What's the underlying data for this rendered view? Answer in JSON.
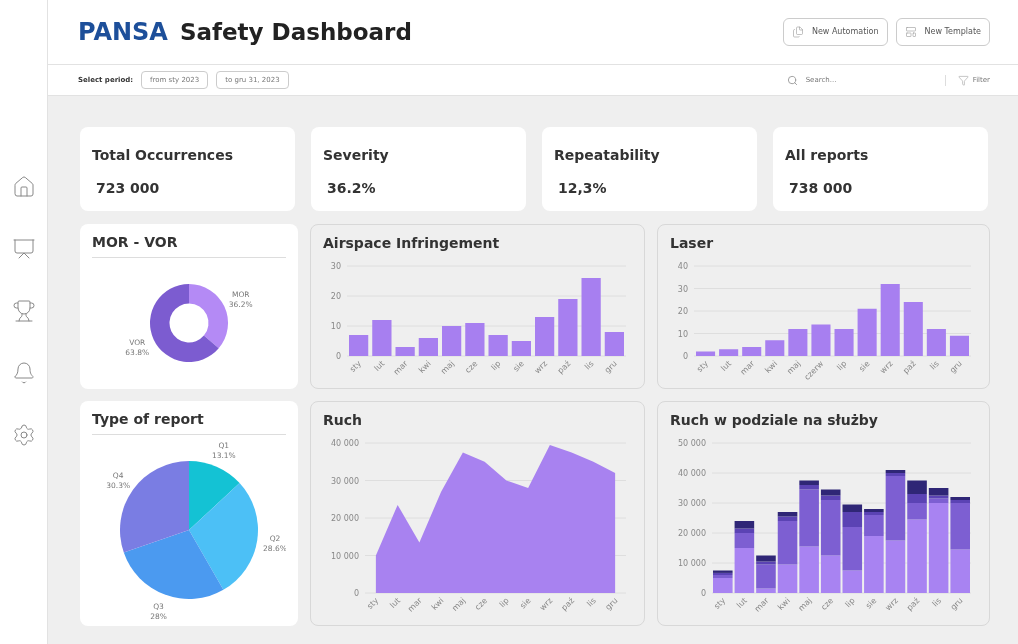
{
  "header": {
    "brand": "PANSA",
    "title": "Safety Dashboard",
    "buttons": [
      {
        "label": "New Automation",
        "kind": "automation"
      },
      {
        "label": "New Template",
        "kind": "template"
      }
    ]
  },
  "filter_bar": {
    "period_label": "Select period:",
    "from": "from sty 2023",
    "to": "to gru 31, 2023",
    "search": {
      "placeholder": "Search..."
    },
    "filter": "Filter"
  },
  "sidebar": {
    "items": [
      {
        "kind": "home"
      },
      {
        "kind": "presentation"
      },
      {
        "kind": "trophy"
      },
      {
        "kind": "bell"
      },
      {
        "kind": "settings"
      }
    ]
  },
  "kpis": [
    {
      "title": "Total Occurrences",
      "value": "723 000"
    },
    {
      "title": "Severity",
      "value": "36.2%"
    },
    {
      "title": "Repeatability",
      "value": "12,3%"
    },
    {
      "title": "All reports",
      "value": "738 000"
    }
  ],
  "charts": [
    {
      "title": "MOR - VOR",
      "chart_data": {
        "type": "donut",
        "categories": [
          "MOR",
          "VOR"
        ],
        "values": [
          36.2,
          63.8
        ],
        "colors": [
          "#b48af5",
          "#7c5cd0"
        ],
        "value_labels": [
          "36.2%",
          "63.8%"
        ]
      }
    },
    {
      "title": "Airspace Infringement",
      "chart_data": {
        "type": "bar",
        "grid": true,
        "categories": [
          "sty",
          "lut",
          "mar",
          "kwi",
          "maj",
          "cze",
          "lip",
          "sie",
          "wrz",
          "paź",
          "lis",
          "gru"
        ],
        "series": [
          {
            "color": "#a77ff0",
            "values": [
              7,
              12,
              3,
              6,
              10,
              11,
              7,
              5,
              13,
              19,
              26,
              8
            ]
          }
        ],
        "ylim": [
          0,
          30
        ],
        "yticks": [
          0,
          10,
          20,
          30
        ]
      }
    },
    {
      "title": "Laser",
      "chart_data": {
        "type": "bar",
        "grid": true,
        "categories": [
          "sty",
          "lut",
          "mar",
          "kwi",
          "maj",
          "czerw",
          "lip",
          "sie",
          "wrz",
          "paź",
          "lis",
          "gru"
        ],
        "series": [
          {
            "color": "#a77ff0",
            "values": [
              2,
              3,
              4,
              7,
              12,
              14,
              12,
              21,
              32,
              24,
              12,
              9
            ]
          }
        ],
        "ylim": [
          0,
          40
        ],
        "yticks": [
          0,
          10,
          20,
          30,
          40
        ]
      }
    },
    {
      "title": "Type of report",
      "chart_data": {
        "type": "pie",
        "categories": [
          "Q1",
          "Q2",
          "Q3",
          "Q4"
        ],
        "values": [
          13.1,
          28.6,
          28,
          30.3
        ],
        "colors": [
          "#14c2d4",
          "#4cc0f6",
          "#4b9af0",
          "#7a7de3"
        ],
        "value_labels": [
          "13.1%",
          "28.6%",
          "28%",
          "30.3%"
        ]
      }
    },
    {
      "title": "Ruch",
      "chart_data": {
        "type": "area",
        "grid": true,
        "categories": [
          "sty",
          "lut",
          "mar",
          "kwi",
          "maj",
          "cze",
          "lip",
          "sie",
          "wrz",
          "paź",
          "lis",
          "gru"
        ],
        "series": [
          {
            "color": "#a882f0",
            "values": [
              10000,
              23500,
              13500,
              27000,
              37500,
              35000,
              30000,
              28000,
              39500,
              37500,
              35000,
              32000
            ]
          }
        ],
        "ylim": [
          0,
          40000
        ],
        "yticks": [
          {
            "value": 0,
            "label": "0"
          },
          {
            "value": 10000,
            "label": "10 000"
          },
          {
            "value": 20000,
            "label": "20 000"
          },
          {
            "value": 30000,
            "label": "30 000"
          },
          {
            "value": 40000,
            "label": "40 000"
          }
        ]
      }
    },
    {
      "title": "Ruch w podziale na służby",
      "chart_data": {
        "type": "bar",
        "grid": true,
        "stacked": true,
        "categories": [
          "sty",
          "lut",
          "mar",
          "kwi",
          "maj",
          "cze",
          "lip",
          "sie",
          "wrz",
          "paź",
          "lis",
          "gru"
        ],
        "series": [
          {
            "color": "#a883f2",
            "values": [
              5000,
              15000,
              1500,
              9500,
              15500,
              12500,
              7500,
              19000,
              17500,
              24500,
              30000,
              14500
            ]
          },
          {
            "color": "#7d5fd2",
            "values": [
              1000,
              5000,
              8000,
              14500,
              19000,
              18500,
              14500,
              7000,
              21500,
              5500,
              1500,
              15500
            ]
          },
          {
            "color": "#5b43b4",
            "values": [
              700,
              1500,
              1000,
              1500,
              1500,
              1500,
              5000,
              1000,
              1000,
              3000,
              1000,
              1000
            ]
          },
          {
            "color": "#2f2676",
            "values": [
              800,
              2500,
              2000,
              1500,
              1500,
              2000,
              2500,
              1000,
              1000,
              4500,
              2500,
              1000
            ]
          }
        ],
        "ylim": [
          0,
          50000
        ],
        "yticks": [
          {
            "value": 0,
            "label": "0"
          },
          {
            "value": 10000,
            "label": "10 000"
          },
          {
            "value": 20000,
            "label": "20 000"
          },
          {
            "value": 30000,
            "label": "30 000"
          },
          {
            "value": 40000,
            "label": "40 000"
          },
          {
            "value": 50000,
            "label": "50 000"
          }
        ]
      }
    }
  ]
}
